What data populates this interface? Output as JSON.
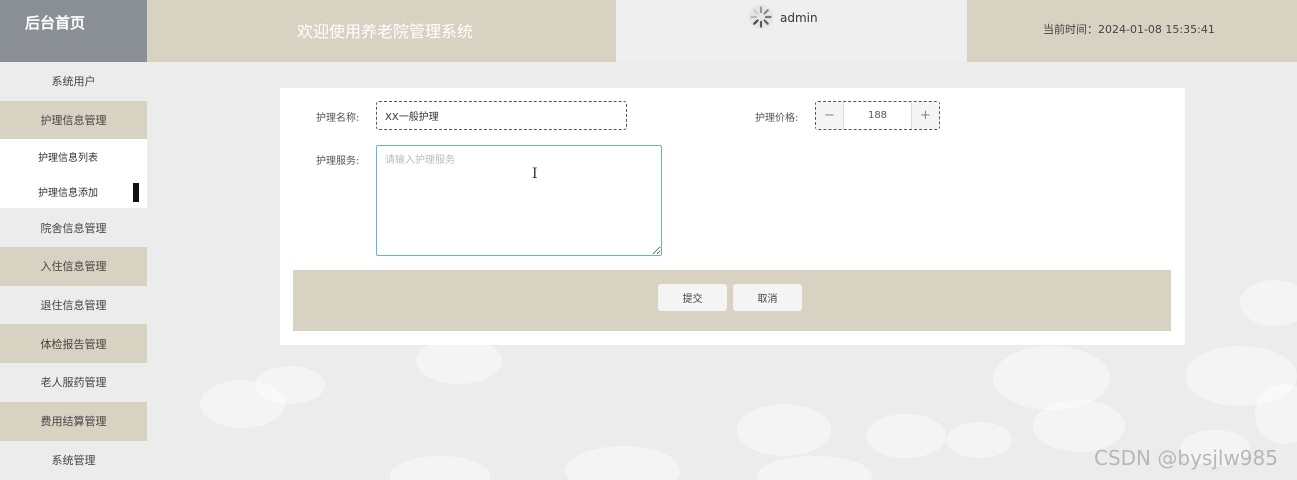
{
  "header": {
    "logo": "后台首页",
    "title": "欢迎使用养老院管理系统",
    "username": "admin",
    "time": "当前时间：2024-01-08 15:35:41"
  },
  "sidebar": {
    "items": [
      {
        "label": "系统用户",
        "shade": "light"
      },
      {
        "label": "护理信息管理",
        "shade": "dark"
      },
      {
        "label": "护理信息列表",
        "sub": true
      },
      {
        "label": "护理信息添加",
        "sub": true,
        "active": true
      },
      {
        "label": "院舍信息管理",
        "shade": "light"
      },
      {
        "label": "入住信息管理",
        "shade": "dark"
      },
      {
        "label": "退住信息管理",
        "shade": "light"
      },
      {
        "label": "体检报告管理",
        "shade": "dark"
      },
      {
        "label": "老人服药管理",
        "shade": "light"
      },
      {
        "label": "费用结算管理",
        "shade": "dark"
      },
      {
        "label": "系统管理",
        "shade": "light"
      }
    ]
  },
  "form": {
    "name_label": "护理名称:",
    "name_value": "XX一般护理",
    "price_label": "护理价格:",
    "price_value": "188",
    "service_label": "护理服务:",
    "service_placeholder": "请输入护理服务",
    "submit_label": "提交",
    "cancel_label": "取消"
  },
  "watermark": "CSDN @bysjlw985",
  "colors": {
    "beige": "#d8d2c3",
    "logo_gray": "#8b9096",
    "page_bg": "#ececec",
    "textarea_focus": "#62b5d8"
  }
}
